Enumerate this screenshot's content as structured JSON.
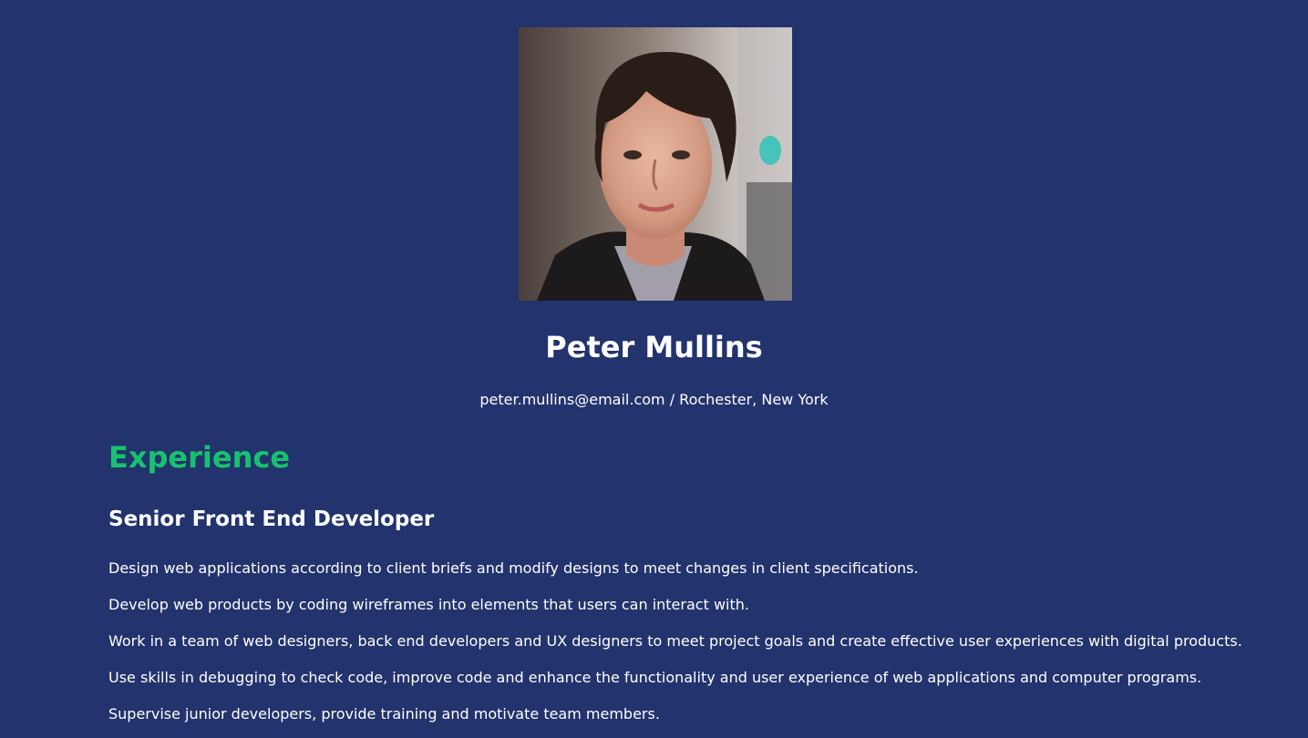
{
  "profile": {
    "name": "Peter Mullins",
    "email": "peter.mullins@email.com",
    "separator": "/",
    "location": "Rochester, New York",
    "contact_line": "peter.mullins@email.com / Rochester, New York",
    "photo_icon": "profile-photo"
  },
  "experience": {
    "section_title": "Experience",
    "jobs": [
      {
        "title": "Senior Front End Developer",
        "duties": [
          "Design web applications according to client briefs and modify designs to meet changes in client specifications.",
          "Develop web products by coding wireframes into elements that users can interact with.",
          "Work in a team of web designers, back end developers and UX designers to meet project goals and create effective user experiences with digital products.",
          "Use skills in debugging to check code, improve code and enhance the functionality and user experience of web applications and computer programs.",
          "Supervise junior developers, provide training and motivate team members."
        ]
      }
    ]
  },
  "colors": {
    "background": "#23336d",
    "accent": "#17c26e",
    "text": "#ffffff"
  }
}
